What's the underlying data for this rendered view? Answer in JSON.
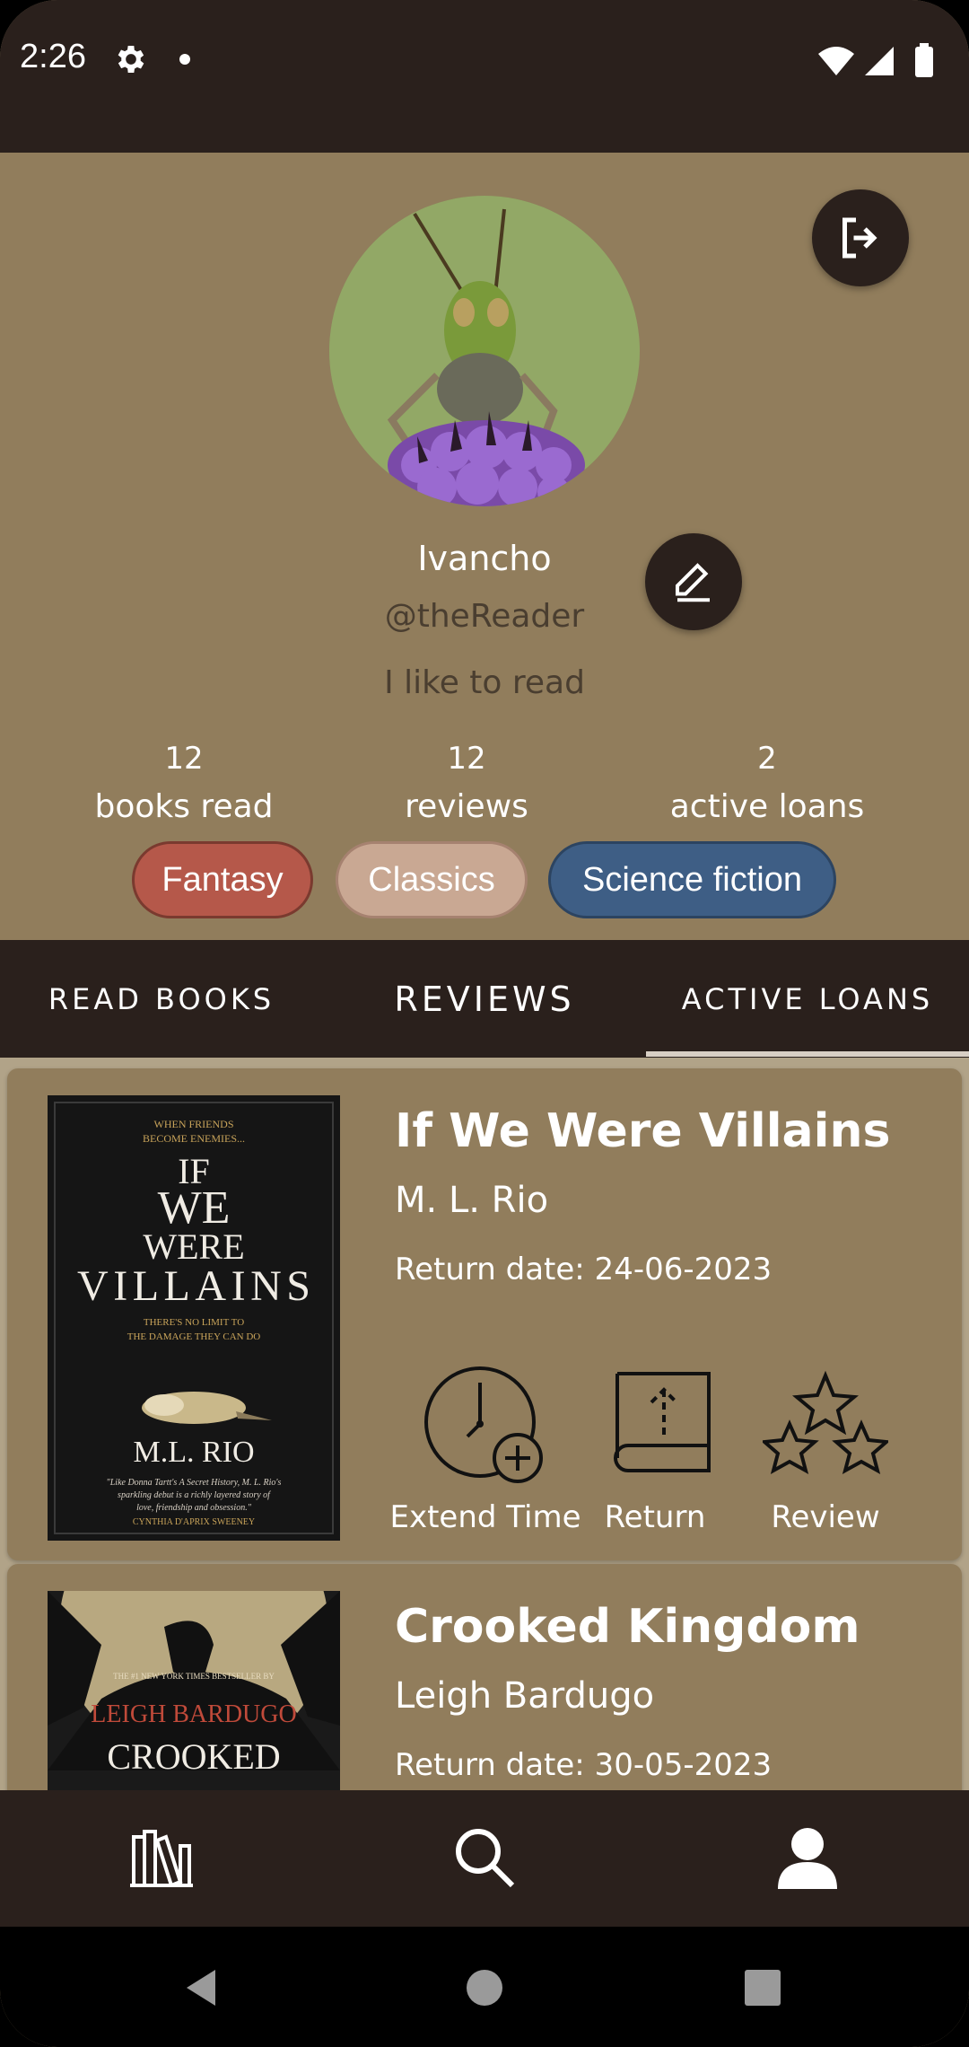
{
  "status_bar": {
    "time": "2:26",
    "icons": [
      "gear-icon",
      "dot-icon",
      "wifi-icon",
      "signal-icon",
      "battery-icon"
    ]
  },
  "profile": {
    "name": "Ivancho",
    "handle": "@theReader",
    "bio": "I like to read",
    "stats": [
      {
        "count": "12",
        "label": "books read"
      },
      {
        "count": "12",
        "label": "reviews"
      },
      {
        "count": "2",
        "label": "active loans"
      }
    ],
    "genres": [
      {
        "label": "Fantasy",
        "color": "#b5584a"
      },
      {
        "label": "Classics",
        "color": "#c9a893"
      },
      {
        "label": "Science fiction",
        "color": "#3e5e85"
      }
    ]
  },
  "tabs": [
    {
      "label": "READ BOOKS",
      "selected": false
    },
    {
      "label": "REVIEWS",
      "selected": false
    },
    {
      "label": "ACTIVE LOANS",
      "selected": true
    }
  ],
  "loans": [
    {
      "title": "If We Were Villains",
      "author": "M. L. Rio",
      "return_date": "Return date: 24-06-2023",
      "cover": {
        "top_line": "WHEN FRIENDS",
        "top_line2": "BECOME ENEMIES...",
        "title_lines": [
          "IF",
          "WE",
          "WERE",
          "VILLAINS"
        ],
        "tagline": "THERE'S NO LIMIT TO",
        "tagline2": "THE DAMAGE THEY CAN DO",
        "author": "M.L. RIO",
        "quote": "\"Like Donna Tartt's A Secret History, M. L. Rio's",
        "quote2": "sparkling debut is a richly layered story of",
        "quote3": "love, friendship and obsession.\"",
        "quote_author": "CYNTHIA D'APRIX SWEENEY"
      },
      "actions": [
        "Extend Time",
        "Return",
        "Review"
      ]
    },
    {
      "title": "Crooked Kingdom",
      "author": "Leigh Bardugo",
      "return_date": "Return date: 30-05-2023",
      "cover": {
        "top_line": "THE #1 NEW YORK TIMES BESTSELLER BY",
        "author": "LEIGH BARDUGO",
        "title": "CROOKED"
      }
    }
  ],
  "bottom_nav": [
    {
      "icon": "library-icon"
    },
    {
      "icon": "search-icon"
    },
    {
      "icon": "profile-icon",
      "selected": true
    }
  ],
  "colors": {
    "background": "#917d5c",
    "dark": "#2a201c",
    "subtle_text": "#4a3e30"
  }
}
